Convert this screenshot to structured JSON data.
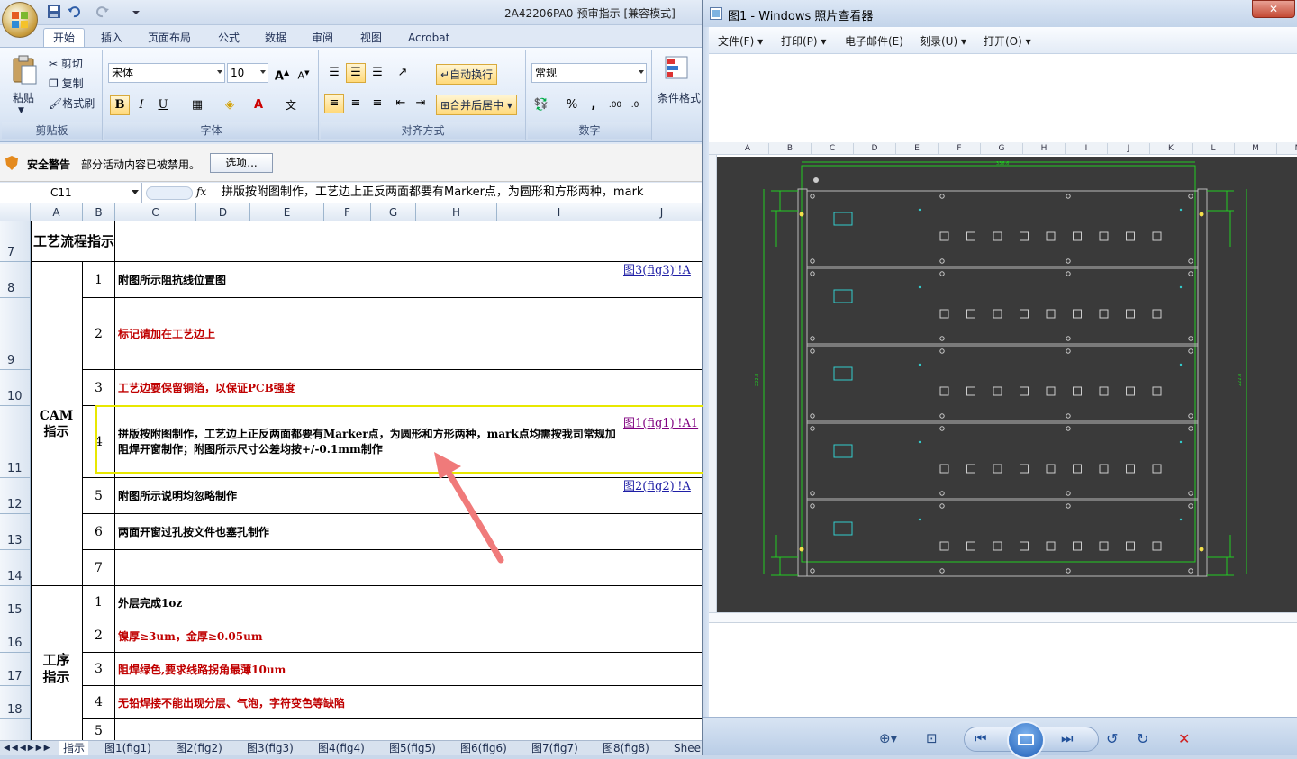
{
  "excel": {
    "doc_title": "2A42206PA0-预审指示  [兼容模式] -",
    "tabs": [
      "开始",
      "插入",
      "页面布局",
      "公式",
      "数据",
      "审阅",
      "视图",
      "Acrobat"
    ],
    "clipboard": {
      "paste": "粘贴",
      "cut": "剪切",
      "copy": "复制",
      "format_painter": "格式刷",
      "label": "剪贴板"
    },
    "font": {
      "name": "宋体",
      "size": "10",
      "label": "字体",
      "bold": "B",
      "italic": "I",
      "underline": "U"
    },
    "alignment": {
      "wrap": "自动换行",
      "merge": "合并后居中",
      "label": "对齐方式"
    },
    "number": {
      "format": "常规",
      "percent": "%",
      "comma": ",",
      "label": "数字"
    },
    "styles": {
      "cond_format": "条件格式"
    },
    "security": {
      "title": "安全警告",
      "message": "部分活动内容已被禁用。",
      "options": "选项..."
    },
    "name_box": "C11",
    "fx": "fx",
    "formula": "拼版按附图制作，工艺边上正反两面都要有Marker点，为圆形和方形两种，mark",
    "columns": [
      "A",
      "B",
      "C",
      "D",
      "E",
      "F",
      "G",
      "H",
      "I",
      "J"
    ],
    "rows": {
      "r7": {
        "num": "7",
        "header": "工艺流程指示"
      },
      "r8": {
        "num": "8",
        "idx": "1",
        "text": "附图所示阻抗线位置图",
        "link": "图3(fig3)'!A"
      },
      "r9": {
        "num": "9",
        "idx": "2",
        "text": "标记请加在工艺边上"
      },
      "r10": {
        "num": "10",
        "idx": "3",
        "text": "工艺边要保留铜箔，以保证PCB强度"
      },
      "r11": {
        "num": "11",
        "idx": "4",
        "text": "拼版按附图制作，工艺边上正反两面都要有Marker点，为圆形和方形两种，mark点均需按我司常规加阻焊开窗制作；附图所示尺寸公差均按+/-0.1mm制作",
        "link": "图1(fig1)'!A1"
      },
      "r12": {
        "num": "12",
        "idx": "5",
        "text": "附图所示说明均忽略制作",
        "link": "图2(fig2)'!A"
      },
      "r13": {
        "num": "13",
        "idx": "6",
        "text": "两面开窗过孔按文件也塞孔制作"
      },
      "r14": {
        "num": "14",
        "idx": "7",
        "text": ""
      },
      "r15": {
        "num": "15",
        "idx": "1",
        "text": "外层完成1oz"
      },
      "r16": {
        "num": "16",
        "idx": "2",
        "text": "镍厚≥3um，金厚≥0.05um"
      },
      "r17": {
        "num": "17",
        "idx": "3",
        "text": "阻焊绿色,要求线路拐角最薄10um"
      },
      "r18": {
        "num": "18",
        "idx": "4",
        "text": "无铅焊接不能出现分层、气泡，字符变色等缺陷"
      },
      "r19": {
        "idx": "5"
      }
    },
    "group_cam": "CAM指示",
    "group_process": "工序指示",
    "sheet_tabs": [
      "指示",
      "图1(fig1)",
      "图2(fig2)",
      "图3(fig3)",
      "图4(fig4)",
      "图5(fig5)",
      "图6(fig6)",
      "图7(fig7)",
      "图8(fig8)",
      "Shee"
    ]
  },
  "viewer": {
    "title": "图1 - Windows 照片查看器",
    "menu": [
      "文件(F)",
      "打印(P)",
      "电子邮件(E)",
      "刻录(U)",
      "打开(O)"
    ],
    "columns": [
      "A",
      "B",
      "C",
      "D",
      "E",
      "F",
      "G",
      "H",
      "I",
      "J",
      "K",
      "L",
      "M",
      "N"
    ],
    "dims": {
      "width": "336.6",
      "height": "222.8"
    }
  },
  "colors": {
    "ribbon_blue": "#dfe8f5",
    "highlight_box": "#e8e800",
    "arrow": "#f07a7a",
    "red_text": "#c00000",
    "pcb_bg": "#3a3a3a",
    "pcb_green": "#22cc22",
    "pcb_cyan": "#33cccc"
  }
}
